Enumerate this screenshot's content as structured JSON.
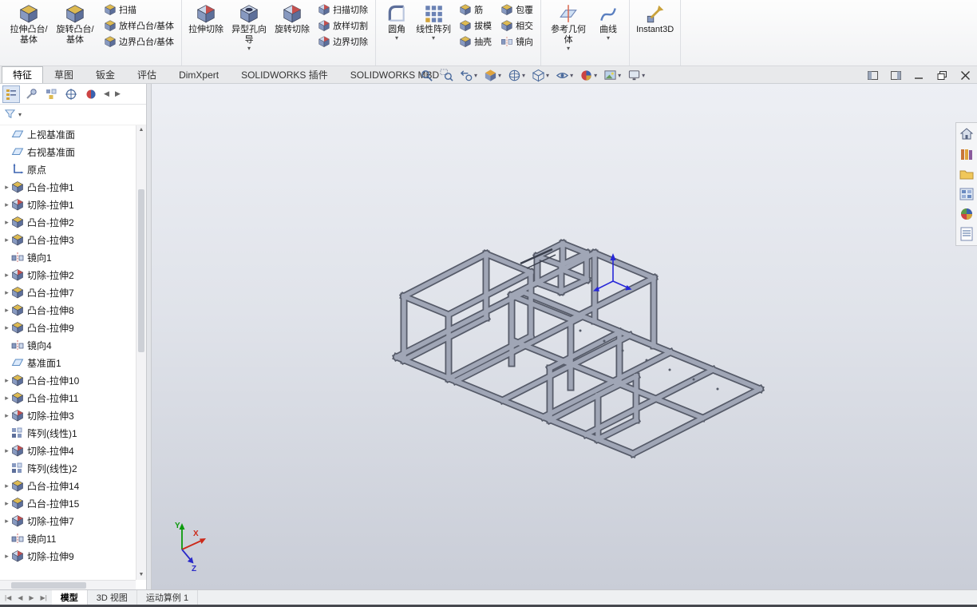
{
  "window": {
    "controls": [
      {
        "name": "pane-left"
      },
      {
        "name": "pane-right"
      },
      {
        "name": "minimize"
      },
      {
        "name": "restore"
      },
      {
        "name": "close"
      }
    ]
  },
  "ribbon": {
    "groups": [
      {
        "large": [
          {
            "label": "拉伸凸台/基体",
            "icon": "extrude-boss"
          },
          {
            "label": "旋转凸台/基体",
            "icon": "revolve-boss"
          }
        ],
        "smalls": [
          [
            {
              "label": "扫描",
              "icon": "sweep"
            },
            {
              "label": "放样凸台/基体",
              "icon": "loft-boss"
            },
            {
              "label": "边界凸台/基体",
              "icon": "boundary-boss"
            }
          ]
        ]
      },
      {
        "large": [
          {
            "label": "拉伸切除",
            "icon": "extrude-cut"
          },
          {
            "label": "异型孔向导",
            "icon": "hole-wizard",
            "dropdown": true
          },
          {
            "label": "旋转切除",
            "icon": "revolve-cut"
          }
        ],
        "smalls": [
          [
            {
              "label": "扫描切除",
              "icon": "sweep-cut"
            },
            {
              "label": "放样切割",
              "icon": "loft-cut"
            },
            {
              "label": "边界切除",
              "icon": "boundary-cut"
            }
          ]
        ]
      },
      {
        "large": [
          {
            "label": "圆角",
            "icon": "fillet",
            "dropdown": true
          },
          {
            "label": "线性阵列",
            "icon": "linear-pattern",
            "dropdown": true
          }
        ],
        "smalls": [
          [
            {
              "label": "筋",
              "icon": "rib"
            },
            {
              "label": "拔模",
              "icon": "draft"
            },
            {
              "label": "抽壳",
              "icon": "shell"
            }
          ],
          [
            {
              "label": "包覆",
              "icon": "wrap"
            },
            {
              "label": "相交",
              "icon": "intersect"
            },
            {
              "label": "镜向",
              "icon": "mirror"
            }
          ]
        ]
      },
      {
        "large": [
          {
            "label": "参考几何体",
            "icon": "reference-geometry",
            "dropdown": true
          },
          {
            "label": "曲线",
            "icon": "curves",
            "dropdown": true
          }
        ]
      },
      {
        "large": [
          {
            "label": "Instant3D",
            "icon": "instant3d"
          }
        ]
      }
    ]
  },
  "cm_tabs": [
    {
      "label": "特征",
      "active": true
    },
    {
      "label": "草图"
    },
    {
      "label": "钣金"
    },
    {
      "label": "评估"
    },
    {
      "label": "DimXpert"
    },
    {
      "label": "SOLIDWORKS 插件"
    },
    {
      "label": "SOLIDWORKS MBD"
    }
  ],
  "headsup": [
    {
      "name": "zoom-fit"
    },
    {
      "name": "zoom-area"
    },
    {
      "name": "previous-view",
      "dropdown": true
    },
    {
      "name": "section-view",
      "dropdown": true
    },
    {
      "name": "view-orientation",
      "dropdown": true
    },
    {
      "name": "display-style",
      "dropdown": true
    },
    {
      "name": "hide-show-items",
      "dropdown": true
    },
    {
      "name": "edit-appearance",
      "dropdown": true
    },
    {
      "name": "apply-scene",
      "dropdown": true
    },
    {
      "name": "view-settings",
      "dropdown": true
    }
  ],
  "panel": {
    "tabs": [
      {
        "name": "feature-manager-design-tree",
        "selected": true
      },
      {
        "name": "property-manager"
      },
      {
        "name": "configuration-manager"
      },
      {
        "name": "dimxpert-manager"
      },
      {
        "name": "display-manager"
      }
    ],
    "nav": [
      "◀",
      "▶"
    ],
    "filter_caret": "▾"
  },
  "tree": {
    "items": [
      {
        "label": "上视基准面",
        "icon": "plane"
      },
      {
        "label": "右视基准面",
        "icon": "plane"
      },
      {
        "label": "原点",
        "icon": "origin"
      },
      {
        "label": "凸台-拉伸1",
        "icon": "boss",
        "exp": true
      },
      {
        "label": "切除-拉伸1",
        "icon": "cut",
        "exp": true
      },
      {
        "label": "凸台-拉伸2",
        "icon": "boss",
        "exp": true
      },
      {
        "label": "凸台-拉伸3",
        "icon": "boss",
        "exp": true
      },
      {
        "label": "镜向1",
        "icon": "mirror"
      },
      {
        "label": "切除-拉伸2",
        "icon": "cut",
        "exp": true
      },
      {
        "label": "凸台-拉伸7",
        "icon": "boss",
        "exp": true
      },
      {
        "label": "凸台-拉伸8",
        "icon": "boss",
        "exp": true
      },
      {
        "label": "凸台-拉伸9",
        "icon": "boss",
        "exp": true
      },
      {
        "label": "镜向4",
        "icon": "mirror"
      },
      {
        "label": "基准面1",
        "icon": "plane"
      },
      {
        "label": "凸台-拉伸10",
        "icon": "boss",
        "exp": true
      },
      {
        "label": "凸台-拉伸11",
        "icon": "boss",
        "exp": true
      },
      {
        "label": "切除-拉伸3",
        "icon": "cut",
        "exp": true
      },
      {
        "label": "阵列(线性)1",
        "icon": "pattern"
      },
      {
        "label": "切除-拉伸4",
        "icon": "cut",
        "exp": true
      },
      {
        "label": "阵列(线性)2",
        "icon": "pattern"
      },
      {
        "label": "凸台-拉伸14",
        "icon": "boss",
        "exp": true
      },
      {
        "label": "凸台-拉伸15",
        "icon": "boss",
        "exp": true
      },
      {
        "label": "切除-拉伸7",
        "icon": "cut",
        "exp": true
      },
      {
        "label": "镜向11",
        "icon": "mirror"
      },
      {
        "label": "切除-拉伸9",
        "icon": "cut",
        "exp": true
      }
    ]
  },
  "viewport": {
    "triad": {
      "x": "X",
      "y": "Y",
      "z": "Z"
    }
  },
  "taskpane": {
    "icons": [
      "home",
      "design-library",
      "file-explorer",
      "view-palette",
      "appearances",
      "custom-properties"
    ]
  },
  "statusbar": {
    "nav": [
      "|◀",
      "◀",
      "▶",
      "▶|"
    ],
    "tabs": [
      {
        "label": "模型",
        "active": true
      },
      {
        "label": "3D 视图"
      },
      {
        "label": "运动算例 1"
      }
    ]
  }
}
